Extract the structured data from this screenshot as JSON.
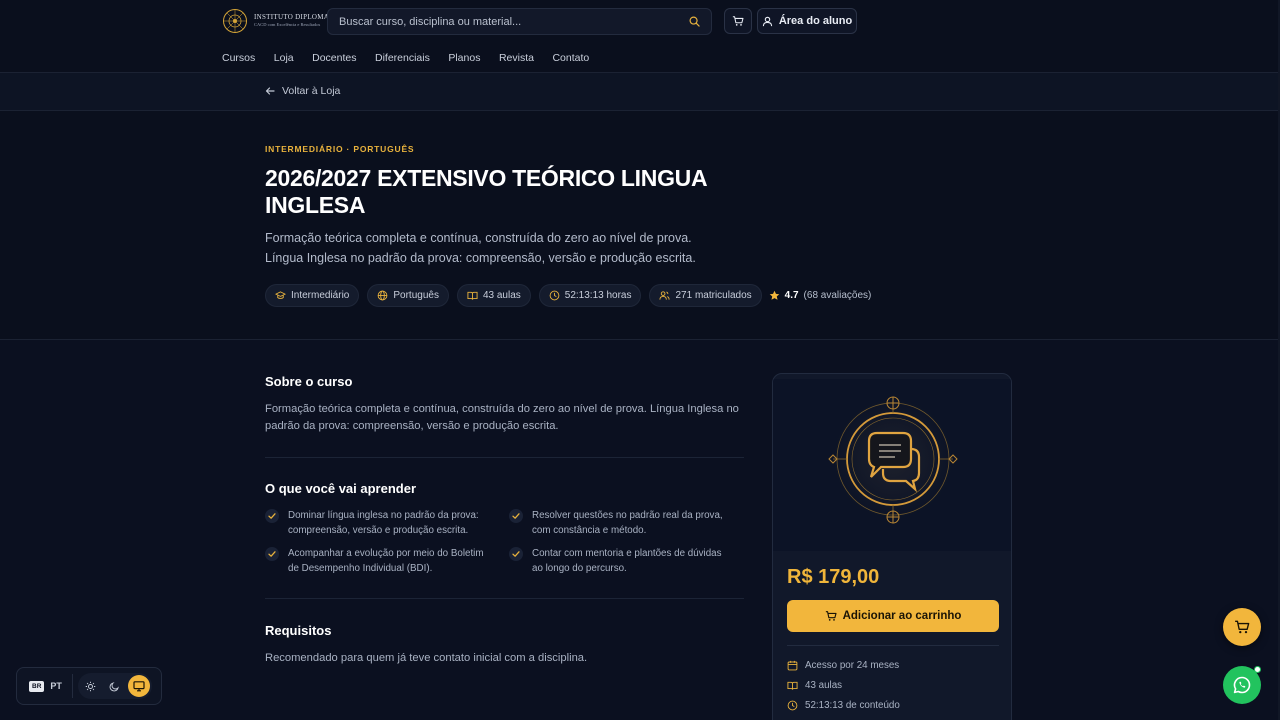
{
  "header": {
    "logo": {
      "line1": "INSTITUTO DIPLOMACIA",
      "line2": "CACD com Excelência e Resultados"
    },
    "search_placeholder": "Buscar curso, disciplina ou material...",
    "aluno_label": "Área do aluno",
    "nav": [
      "Cursos",
      "Loja",
      "Docentes",
      "Diferenciais",
      "Planos",
      "Revista",
      "Contato"
    ]
  },
  "back_label": "Voltar à Loja",
  "hero": {
    "eyebrow": "INTERMEDIÁRIO · PORTUGUÊS",
    "title": "2026/2027 EXTENSIVO TEÓRICO LINGUA INGLESA",
    "subtitle_line1": "Formação teórica completa e contínua, construída do zero ao nível de prova.",
    "subtitle_line2": "Língua Inglesa no padrão da prova: compreensão, versão e produção escrita.",
    "chips": {
      "level": "Intermediário",
      "language": "Português",
      "lessons": "43 aulas",
      "hours": "52:13:13 horas",
      "enrolled": "271 matriculados"
    },
    "rating": {
      "value": "4.7",
      "count": "(68 avaliações)"
    }
  },
  "about": {
    "heading": "Sobre o curso",
    "text": "Formação teórica completa e contínua, construída do zero ao nível de prova. Língua Inglesa no padrão da prova: compreensão, versão e produção escrita."
  },
  "learn": {
    "heading": "O que você vai aprender",
    "items": [
      "Dominar língua inglesa no padrão da prova: compreensão, versão e produção escrita.",
      "Resolver questões no padrão real da prova, com constância e método.",
      "Acompanhar a evolução por meio do Boletim de Desempenho Individual (BDI).",
      "Contar com mentoria e plantões de dúvidas ao longo do percurso."
    ]
  },
  "requirements": {
    "heading": "Requisitos",
    "text": "Recomendado para quem já teve contato inicial com a disciplina."
  },
  "card": {
    "price": "R$ 179,00",
    "add_to_cart": "Adicionar ao carrinho",
    "features": [
      "Acesso por 24 meses",
      "43 aulas",
      "52:13:13 de conteúdo"
    ]
  },
  "prefs": {
    "flag": "BR",
    "lang": "PT"
  },
  "colors": {
    "accent": "#f2b63c",
    "whatsapp": "#22c35e",
    "background": "#0b1020"
  }
}
